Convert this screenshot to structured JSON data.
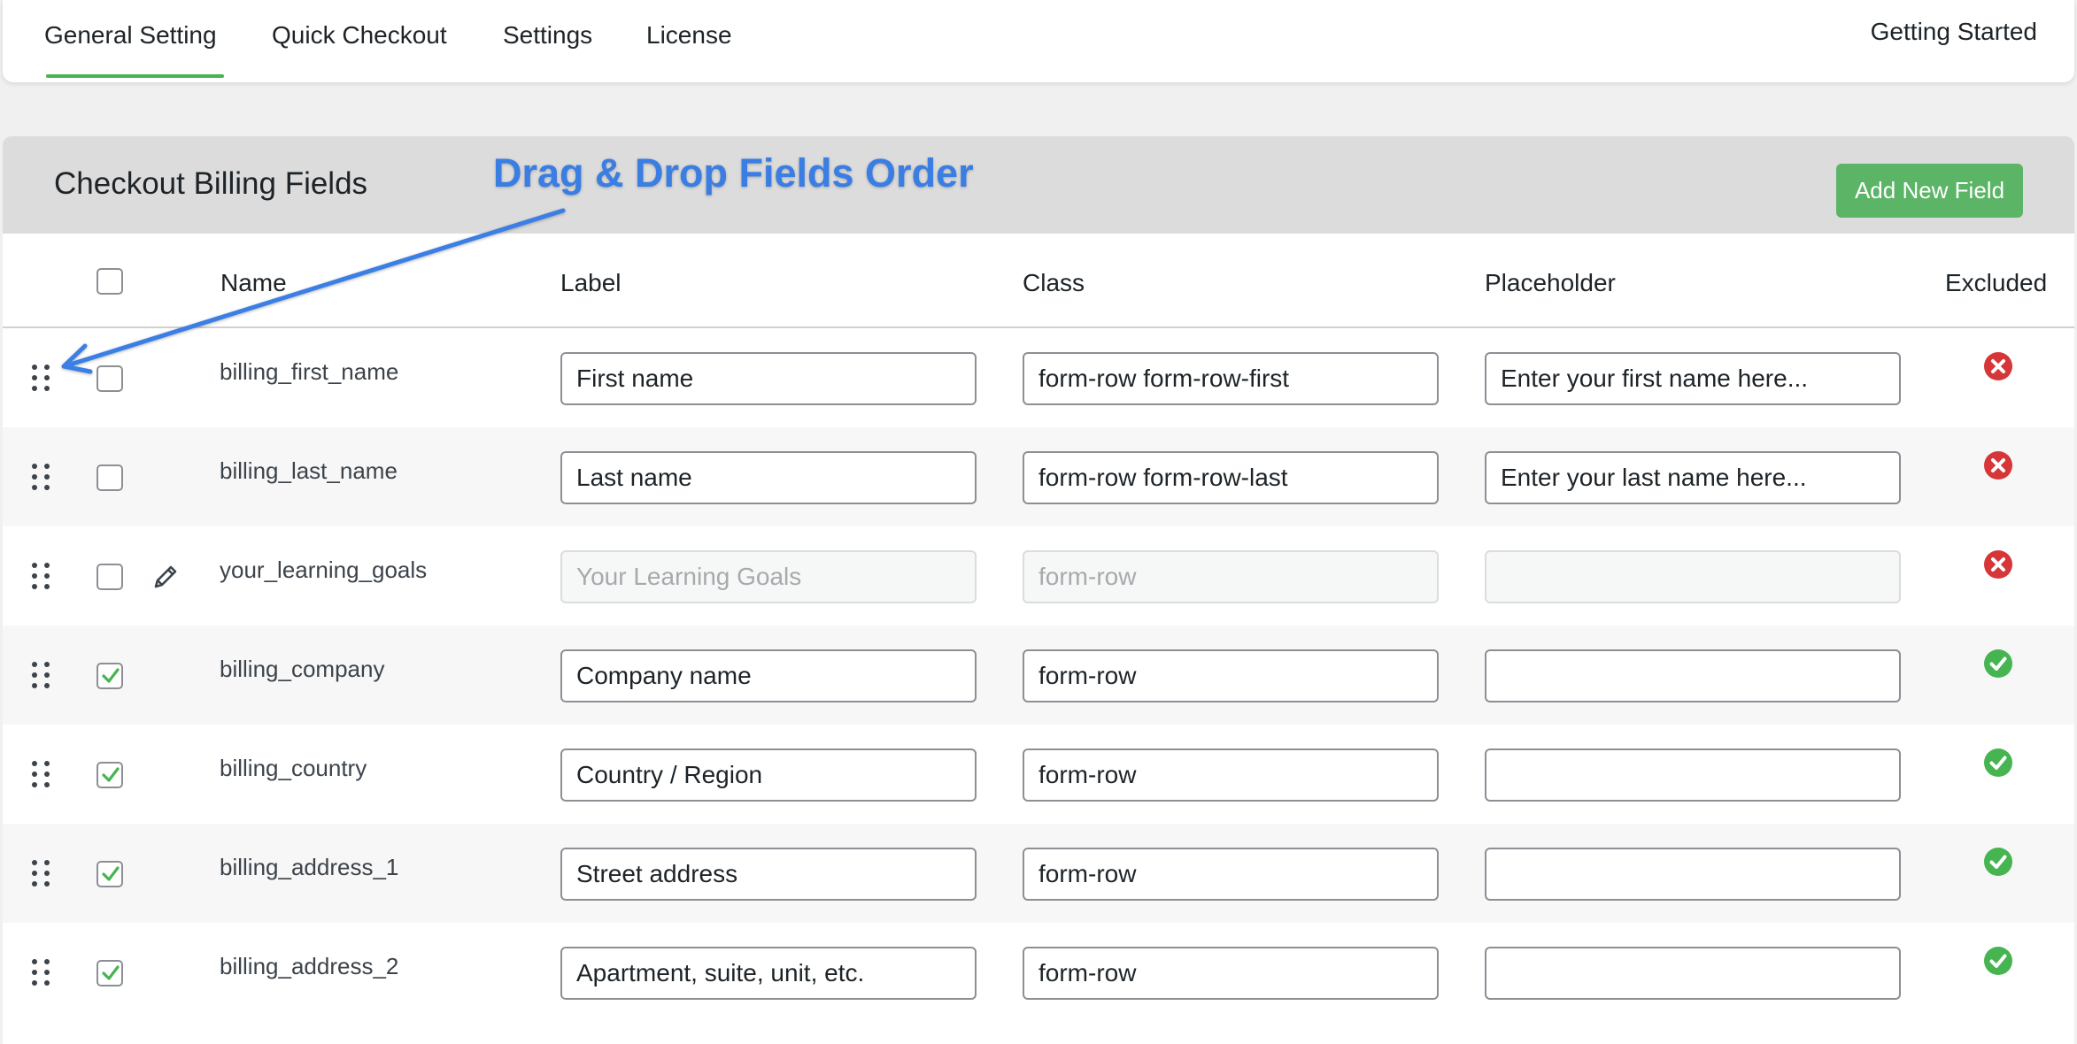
{
  "nav": {
    "tabs": [
      {
        "label": "General Setting",
        "active": true
      },
      {
        "label": "Quick Checkout",
        "active": false
      },
      {
        "label": "Settings",
        "active": false
      },
      {
        "label": "License",
        "active": false
      }
    ],
    "getting_started": "Getting Started"
  },
  "panel": {
    "title": "Checkout Billing Fields",
    "add_button": "Add New Field",
    "annotation": "Drag & Drop Fields Order"
  },
  "table": {
    "headers": {
      "name": "Name",
      "label": "Label",
      "class": "Class",
      "placeholder": "Placeholder",
      "excluded": "Excluded"
    },
    "rows": [
      {
        "name": "billing_first_name",
        "label": "First name",
        "class": "form-row form-row-first",
        "placeholder": "Enter your first name here...",
        "checked": false,
        "editable": false,
        "disabled": false,
        "excluded": true
      },
      {
        "name": "billing_last_name",
        "label": "Last name",
        "class": "form-row form-row-last",
        "placeholder": "Enter your last name here...",
        "checked": false,
        "editable": false,
        "disabled": false,
        "excluded": true
      },
      {
        "name": "your_learning_goals",
        "label": "Your Learning Goals",
        "class": "form-row",
        "placeholder": "",
        "checked": false,
        "editable": true,
        "disabled": true,
        "excluded": true
      },
      {
        "name": "billing_company",
        "label": "Company name",
        "class": "form-row",
        "placeholder": "",
        "checked": true,
        "editable": false,
        "disabled": false,
        "excluded": false
      },
      {
        "name": "billing_country",
        "label": "Country / Region",
        "class": "form-row",
        "placeholder": "",
        "checked": true,
        "editable": false,
        "disabled": false,
        "excluded": false
      },
      {
        "name": "billing_address_1",
        "label": "Street address",
        "class": "form-row",
        "placeholder": "",
        "checked": true,
        "editable": false,
        "disabled": false,
        "excluded": false
      },
      {
        "name": "billing_address_2",
        "label": "Apartment, suite, unit, etc.",
        "class": "form-row",
        "placeholder": "",
        "checked": true,
        "editable": false,
        "disabled": false,
        "excluded": false
      }
    ]
  },
  "colors": {
    "accent_green": "#46b450",
    "button_green": "#5cb466",
    "annotation_blue": "#3a7ee4",
    "excluded_red": "#d63638",
    "included_green": "#46b450"
  },
  "icons": {
    "drag": "drag-handle-icon",
    "edit": "pencil-icon",
    "excluded": "x-circle-icon",
    "included": "check-circle-icon"
  }
}
